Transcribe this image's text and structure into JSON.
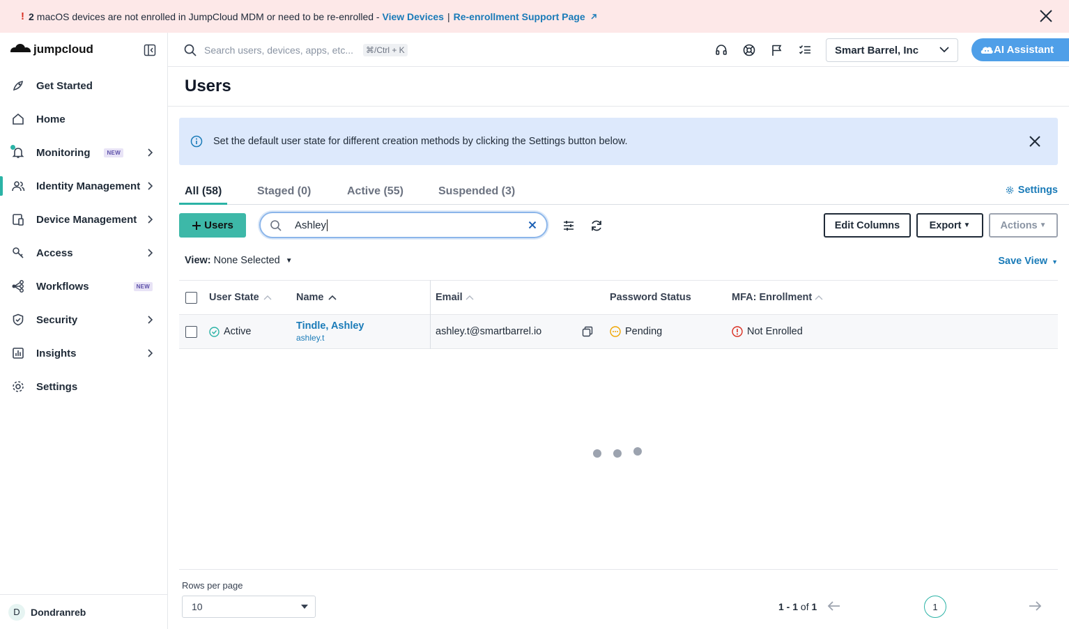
{
  "banner": {
    "count": "2",
    "message": "macOS devices are not enrolled in JumpCloud MDM or need to be re-enrolled -",
    "link1": "View Devices",
    "separator": "|",
    "link2": "Re-enrollment Support Page"
  },
  "app": {
    "brand": "jumpcloud"
  },
  "sidebar": {
    "items": [
      {
        "label": "Get Started",
        "icon": "rocket-icon",
        "chevron": false
      },
      {
        "label": "Home",
        "icon": "home-icon",
        "chevron": false
      },
      {
        "label": "Monitoring",
        "icon": "bell-icon",
        "badge": "NEW",
        "chevron": true
      },
      {
        "label": "Identity Management",
        "icon": "users-icon",
        "chevron": true,
        "active": true
      },
      {
        "label": "Device Management",
        "icon": "devices-icon",
        "chevron": true
      },
      {
        "label": "Access",
        "icon": "key-icon",
        "chevron": true
      },
      {
        "label": "Workflows",
        "icon": "workflow-icon",
        "badge": "NEW",
        "chevron": false
      },
      {
        "label": "Security",
        "icon": "shield-icon",
        "chevron": true
      },
      {
        "label": "Insights",
        "icon": "chart-icon",
        "chevron": true
      },
      {
        "label": "Settings",
        "icon": "gear-icon",
        "chevron": false
      }
    ],
    "user": {
      "initial": "D",
      "name": "Dondranreb"
    }
  },
  "topbar": {
    "search_placeholder": "Search users, devices, apps, etc...",
    "shortcut": "⌘/Ctrl + K",
    "org": "Smart Barrel, Inc",
    "ai_label": "AI Assistant"
  },
  "page": {
    "title": "Users",
    "info": "Set the default user state for different creation methods by clicking the Settings button below.",
    "tabs": [
      "All (58)",
      "Staged (0)",
      "Active (55)",
      "Suspended (3)"
    ],
    "settings_label": "Settings",
    "add_users_label": "Users",
    "search_value": "Ashley",
    "edit_columns": "Edit Columns",
    "export": "Export",
    "actions": "Actions",
    "view_label": "View:",
    "view_value": "None Selected",
    "save_view": "Save View"
  },
  "table": {
    "headers": {
      "state": "User State",
      "name": "Name",
      "email": "Email",
      "password": "Password Status",
      "mfa": "MFA: Enrollment"
    },
    "rows": [
      {
        "state": "Active",
        "name": "Tindle, Ashley",
        "username": "ashley.t",
        "email": "ashley.t@smartbarrel.io",
        "password": "Pending",
        "mfa": "Not Enrolled"
      }
    ]
  },
  "pagination": {
    "rows_label": "Rows per page",
    "rows_value": "10",
    "range": "1 - 1",
    "of": "of",
    "total": "1",
    "page": "1"
  },
  "colors": {
    "accent": "#2bb3a6",
    "link": "#1a7bb8",
    "error": "#d92d20",
    "warn": "#f0a500"
  }
}
